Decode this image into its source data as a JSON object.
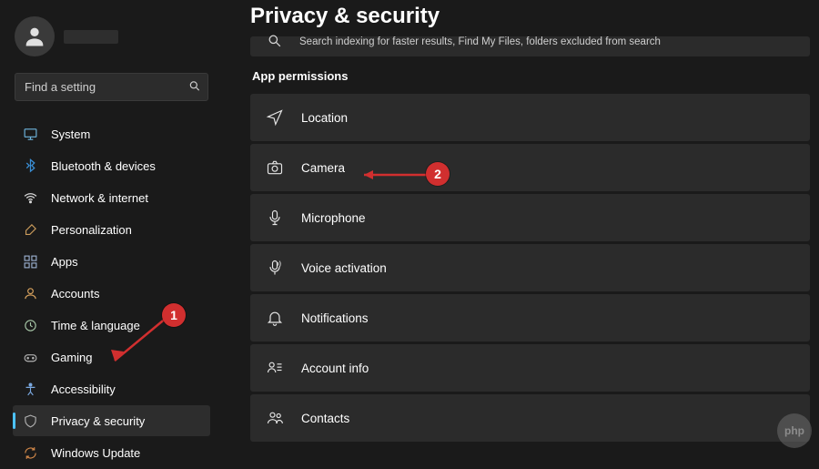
{
  "header": {
    "page_title": "Privacy & security"
  },
  "user": {
    "name_hidden": true
  },
  "search": {
    "placeholder": "Find a setting"
  },
  "sidebar": {
    "items": [
      {
        "label": "System",
        "icon": "system"
      },
      {
        "label": "Bluetooth & devices",
        "icon": "bluetooth"
      },
      {
        "label": "Network & internet",
        "icon": "wifi"
      },
      {
        "label": "Personalization",
        "icon": "brush"
      },
      {
        "label": "Apps",
        "icon": "apps"
      },
      {
        "label": "Accounts",
        "icon": "person"
      },
      {
        "label": "Time & language",
        "icon": "clock"
      },
      {
        "label": "Gaming",
        "icon": "game"
      },
      {
        "label": "Accessibility",
        "icon": "accessibility"
      },
      {
        "label": "Privacy & security",
        "icon": "shield",
        "selected": true
      },
      {
        "label": "Windows Update",
        "icon": "update"
      }
    ]
  },
  "main": {
    "partial_row": {
      "subtitle": "Search indexing for faster results, Find My Files, folders excluded from search"
    },
    "section_label": "App permissions",
    "rows": [
      {
        "label": "Location",
        "icon": "location"
      },
      {
        "label": "Camera",
        "icon": "camera"
      },
      {
        "label": "Microphone",
        "icon": "mic"
      },
      {
        "label": "Voice activation",
        "icon": "voice"
      },
      {
        "label": "Notifications",
        "icon": "bell"
      },
      {
        "label": "Account info",
        "icon": "account"
      },
      {
        "label": "Contacts",
        "icon": "contacts"
      }
    ]
  },
  "annotations": {
    "callout1": "1",
    "callout2": "2"
  },
  "watermark": {
    "text": "php"
  },
  "colors": {
    "accent": "#4cc2ff",
    "callout": "#d12f2f",
    "row_bg": "#2b2b2b"
  }
}
